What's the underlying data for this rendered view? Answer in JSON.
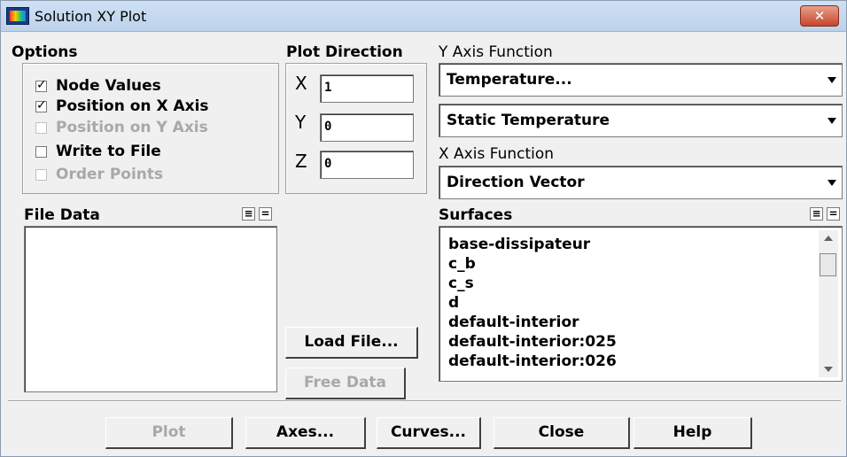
{
  "window": {
    "title": "Solution XY Plot",
    "close": "✕"
  },
  "options": {
    "label": "Options",
    "items": [
      {
        "label": "Node Values",
        "checked": true,
        "enabled": true
      },
      {
        "label": "Position on X Axis",
        "checked": true,
        "enabled": true
      },
      {
        "label": "Position on Y Axis",
        "checked": false,
        "enabled": false
      },
      {
        "label": "Write to File",
        "checked": false,
        "enabled": true
      },
      {
        "label": "Order Points",
        "checked": false,
        "enabled": false
      }
    ]
  },
  "plot_direction": {
    "label": "Plot Direction",
    "x_label": "X",
    "x_value": "1",
    "y_label": "Y",
    "y_value": "0",
    "z_label": "Z",
    "z_value": "0"
  },
  "y_axis": {
    "label": "Y Axis Function",
    "category": "Temperature...",
    "quantity": "Static Temperature"
  },
  "x_axis": {
    "label": "X Axis Function",
    "value": "Direction Vector"
  },
  "file_data": {
    "label": "File Data",
    "load": "Load File...",
    "free": "Free Data"
  },
  "surfaces": {
    "label": "Surfaces",
    "items": [
      "base-dissipateur",
      "c_b",
      "c_s",
      "d",
      "default-interior",
      "default-interior:025",
      "default-interior:026"
    ]
  },
  "list_icons": {
    "select_all": "≡",
    "deselect_all": "="
  },
  "buttons": {
    "plot": "Plot",
    "axes": "Axes...",
    "curves": "Curves...",
    "close": "Close",
    "help": "Help"
  }
}
